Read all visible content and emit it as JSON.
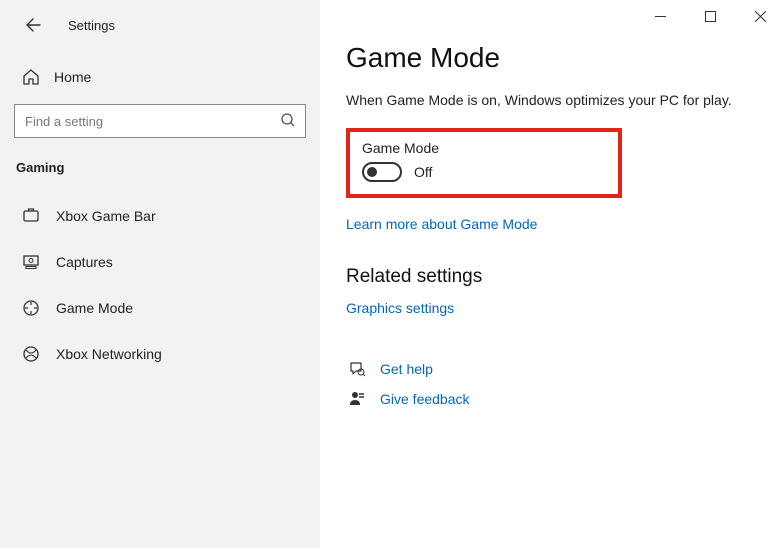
{
  "window": {
    "title": "Settings"
  },
  "sidebar": {
    "home": "Home",
    "search_placeholder": "Find a setting",
    "category": "Gaming",
    "items": [
      {
        "label": "Xbox Game Bar"
      },
      {
        "label": "Captures"
      },
      {
        "label": "Game Mode"
      },
      {
        "label": "Xbox Networking"
      }
    ]
  },
  "main": {
    "title": "Game Mode",
    "description": "When Game Mode is on, Windows optimizes your PC for play.",
    "toggle_label": "Game Mode",
    "toggle_state": "Off",
    "learn_more": "Learn more about Game Mode",
    "related_title": "Related settings",
    "graphics_link": "Graphics settings",
    "get_help": "Get help",
    "give_feedback": "Give feedback"
  }
}
